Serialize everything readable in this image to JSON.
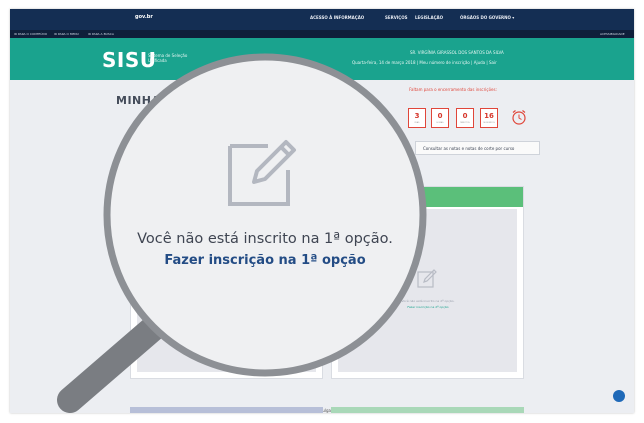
{
  "gov_bar": {
    "brand": "gov.br",
    "links": [
      "ACESSO À INFORMAÇÃO",
      "SERVIÇOS",
      "LEGISLAÇÃO",
      "ÓRGÃOS DO GOVERNO ▾"
    ]
  },
  "sub_bar": {
    "links": [
      "IR PARA O CONTEÚDO",
      "IR PARA O MENU",
      "IR PARA A BUSCA",
      "ACESSIBILIDADE"
    ]
  },
  "header": {
    "logo": "SISU",
    "logo_sub": "Sistema de Seleção Unificada",
    "user_line": "SR. VIRGÍNIA GIRASSOL DOS SANTOS DA SILVA",
    "status_line": "Quarta-feira, 14 de março 2018  |  Meu número de inscrição  |  Ajuda  |  Sair"
  },
  "page": {
    "title": "MINHA INSCRIÇÃO",
    "countdown_label": "Faltam para o encerramento das inscrições:",
    "countdown": [
      {
        "value": "3",
        "unit": "DIAS"
      },
      {
        "value": "0",
        "unit": "HORAS"
      },
      {
        "value": "0",
        "unit": "MINUTOS"
      },
      {
        "value": "16",
        "unit": "SEGUNDOS"
      }
    ],
    "results_button": "Consultar as notas e notas de corte por curso",
    "option2": {
      "text": "Você não está inscrito na 2ª opção.",
      "link": "Fazer inscrição na 2ª opção"
    },
    "footnote": "A próxima classificação parcial será divulgada em 15/03/2018 a partir de 00h."
  },
  "magnifier": {
    "message": "Você não está inscrito na 1ª opção.",
    "link": "Fazer inscrição na 1ª opção"
  },
  "colors": {
    "gov_bar": "#142e53",
    "header_teal": "#1aa38e",
    "option_header_green": "#5bbf7a",
    "countdown_red": "#e0463a",
    "link_blue": "#234c85"
  }
}
